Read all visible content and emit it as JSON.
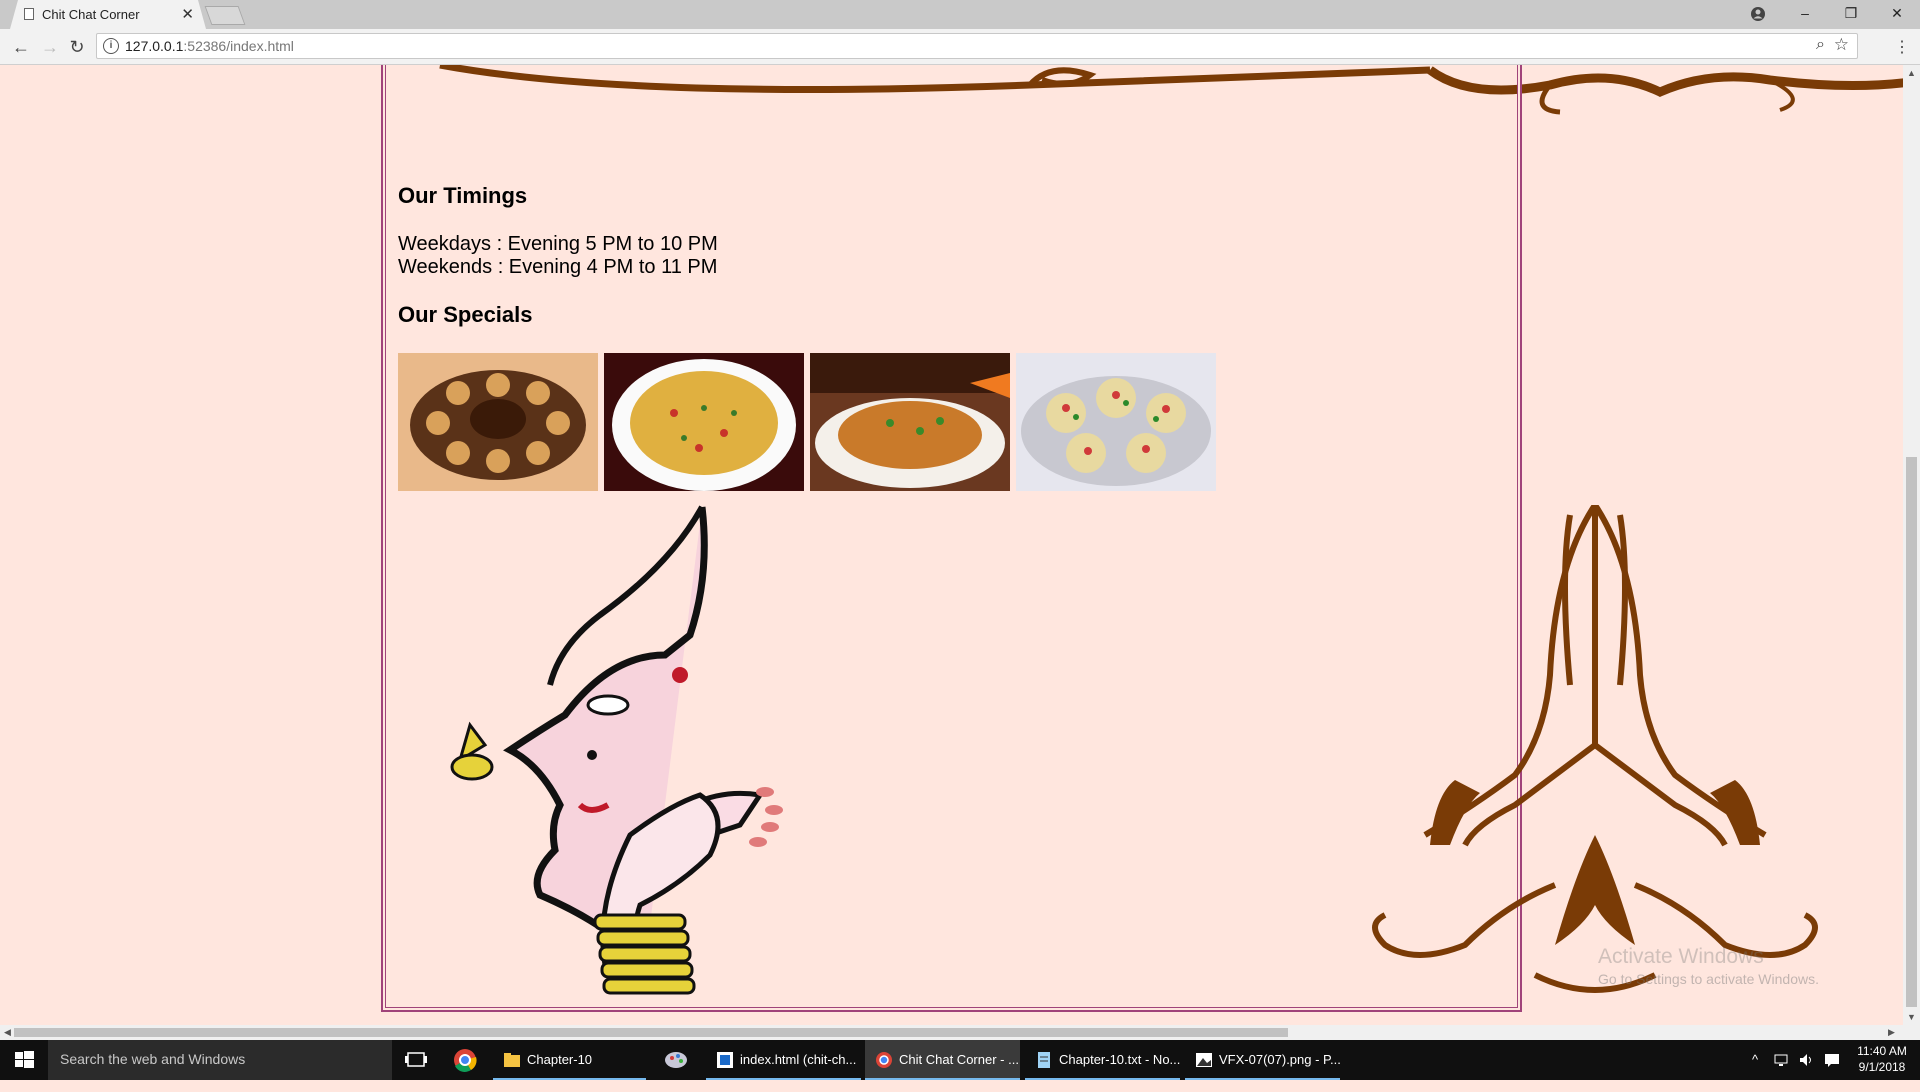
{
  "browser": {
    "tab_title": "Chit Chat Corner",
    "tab_close": "✕",
    "url_host": "127.0.0.1",
    "url_rest": ":52386/index.html",
    "window_controls": [
      "–",
      "❐",
      "✕"
    ]
  },
  "page": {
    "timings_heading": "Our Timings",
    "timings": [
      "Weekdays : Evening 5 PM to 10 PM",
      "Weekends : Evening 4 PM to 11 PM"
    ],
    "specials_heading": "Our Specials",
    "specials": [
      "pani-puri",
      "sev-puri",
      "bhel-puri",
      "dahi-puri"
    ]
  },
  "watermark": {
    "line1": "Activate Windows",
    "line2": "Go to Settings to activate Windows."
  },
  "taskbar": {
    "search_placeholder": "Search the web and Windows",
    "items": [
      {
        "label": "Chapter-10",
        "icon": "folder-icon"
      },
      {
        "label": "index.html (chit-ch...",
        "icon": "editor-icon"
      },
      {
        "label": "Chit Chat Corner - ...",
        "icon": "chrome-icon"
      },
      {
        "label": "Chapter-10.txt - No...",
        "icon": "notepad-icon"
      },
      {
        "label": "VFX-07(07).png - P...",
        "icon": "paint-icon"
      }
    ],
    "clock_time": "11:40 AM",
    "clock_date": "9/1/2018"
  },
  "colors": {
    "page_bg": "#ffe6de",
    "frame_border": "#a0437a",
    "ornament": "#7a3b06"
  }
}
